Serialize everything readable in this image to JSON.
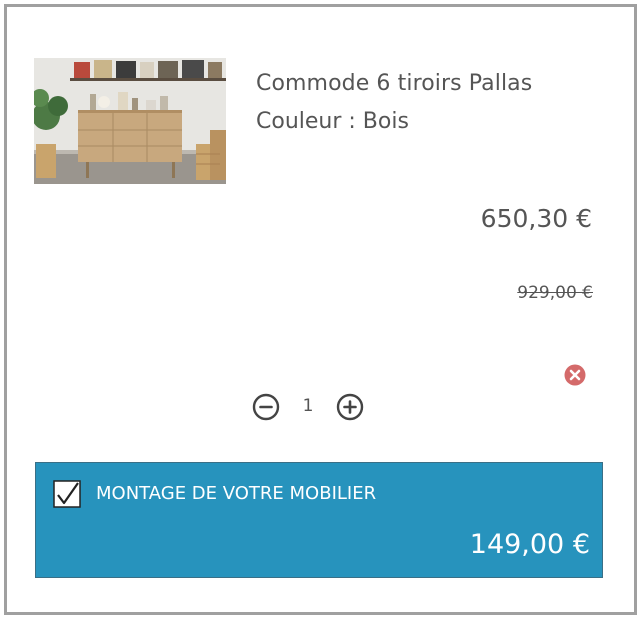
{
  "product": {
    "image_alt": "Commode 6 tiroirs Pallas",
    "name": "Commode 6 tiroirs Pallas",
    "variant": "Couleur : Bois",
    "price": "650,30 €",
    "old_price": "929,00 €",
    "quantity": "1",
    "remove_icon": "remove-icon"
  },
  "service": {
    "checked": true,
    "label": "MONTAGE DE VOTRE MOBILIER",
    "price": "149,00 €",
    "color": "#2793bd"
  },
  "colors": {
    "text": "#555555",
    "remove": "#d46a6a",
    "frame": "#a0a0a0"
  }
}
